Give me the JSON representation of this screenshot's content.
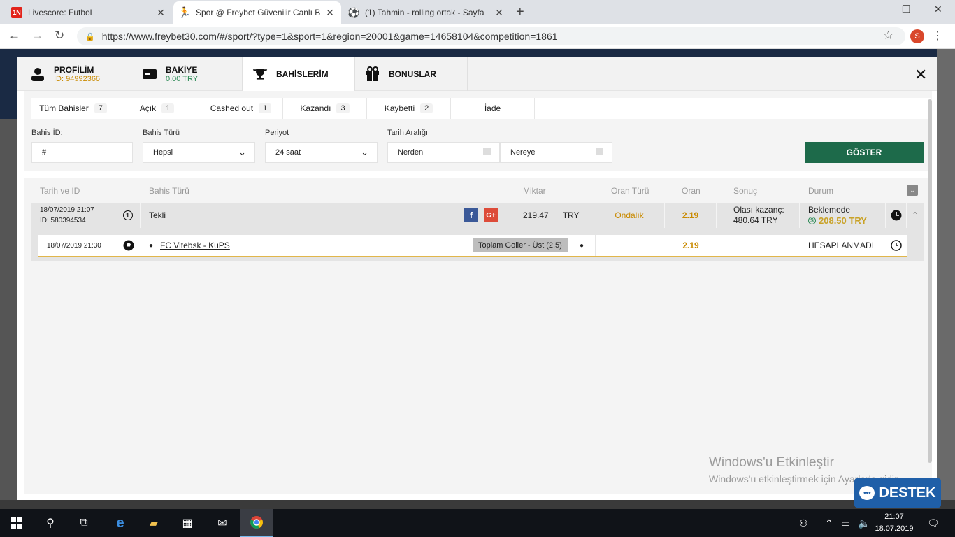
{
  "browser": {
    "tabs": [
      {
        "title": "Livescore: Futbol",
        "favicon": "1N"
      },
      {
        "title": "Spor @ Freybet Güvenilir Canlı B",
        "favicon": ""
      },
      {
        "title": "(1) Tahmin - rolling ortak - Sayfa",
        "favicon": ""
      }
    ],
    "url": "https://www.freybet30.com/#/sport/?type=1&sport=1&region=20001&game=14658104&competition=1861",
    "avatar_letter": "S"
  },
  "modal": {
    "tabs": [
      {
        "label": "PROFİLİM",
        "sub": "ID: 94992366",
        "sub_color": "#c98a00"
      },
      {
        "label": "BAKİYE",
        "sub": "0.00 TRY",
        "sub_color": "#2e8b57"
      },
      {
        "label": "BAHİSLERİM",
        "sub": ""
      },
      {
        "label": "BONUSLAR",
        "sub": ""
      }
    ],
    "filter_tabs": [
      {
        "label": "Tüm Bahisler",
        "count": "7"
      },
      {
        "label": "Açık",
        "count": "1"
      },
      {
        "label": "Cashed out",
        "count": "1"
      },
      {
        "label": "Kazandı",
        "count": "3"
      },
      {
        "label": "Kaybetti",
        "count": "2"
      },
      {
        "label": "İade",
        "count": ""
      }
    ],
    "filters": {
      "bet_id_label": "Bahis İD:",
      "bet_id_value": "#",
      "bet_type_label": "Bahis Türü",
      "bet_type_value": "Hepsi",
      "period_label": "Periyot",
      "period_value": "24 saat",
      "date_range_label": "Tarih Aralığı",
      "from_value": "Nerden",
      "to_value": "Nereye",
      "show_button": "GÖSTER"
    },
    "table": {
      "headers": [
        "Tarih ve ID",
        "Bahis Türü",
        "Miktar",
        "Oran Türü",
        "Oran",
        "Sonuç",
        "Durum"
      ],
      "bet": {
        "date": "18/07/2019 21:07",
        "id": "ID: 580394534",
        "type_icon": "1",
        "type": "Tekli",
        "amount": "219.47",
        "currency": "TRY",
        "odds_type": "Ondalık",
        "odds": "2.19",
        "result_label": "Olası kazanç:",
        "result_value": "480.64 TRY",
        "status": "Beklemede",
        "cashout": "208.50 TRY"
      },
      "selection": {
        "date": "18/07/2019 21:30",
        "match": "FC Vitebsk - KuPS",
        "market": "Toplam Goller - Üst (2.5)",
        "odds": "2.19",
        "status": "HESAPLANMADI"
      }
    }
  },
  "watermark": {
    "line1": "Windows'u Etkinleştir",
    "line2": "Windows'u etkinleştirmek için Ayarlar'a gidin."
  },
  "support_button": "DESTEK",
  "taskbar": {
    "time": "21:07",
    "date": "18.07.2019"
  },
  "colors": {
    "accent_green": "#1d6a4a",
    "odds_orange": "#c98a00",
    "cashout_gold": "#c9a227"
  }
}
